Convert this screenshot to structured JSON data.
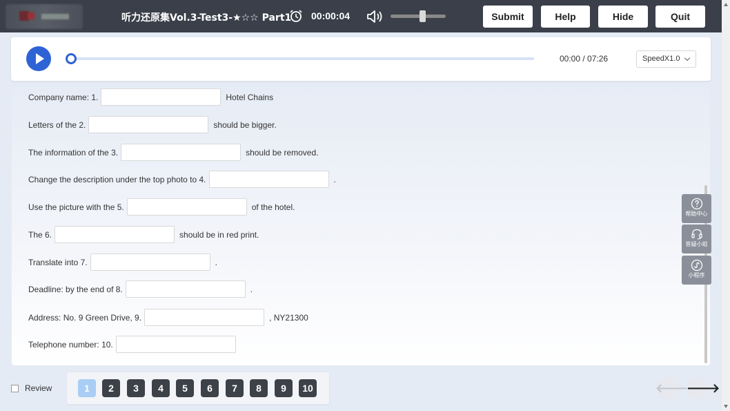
{
  "header": {
    "title": "听力还原集Vol.3-Test3-★☆☆ Part1",
    "timer": "00:00:04",
    "volume_level": 0.58,
    "buttons": {
      "submit": "Submit",
      "help": "Help",
      "hide": "Hide",
      "quit": "Quit"
    }
  },
  "player": {
    "time": "00:00 / 07:26",
    "speed": "SpeedX1.0",
    "progress": 0
  },
  "questions": [
    {
      "before": "Company name: 1.",
      "after": "Hotel Chains",
      "value": ""
    },
    {
      "before": "Letters of the 2.",
      "after": "should be bigger.",
      "value": ""
    },
    {
      "before": "The information of the 3.",
      "after": "should be removed.",
      "value": ""
    },
    {
      "before": "Change the description under the top photo to 4.",
      "after": ".",
      "value": ""
    },
    {
      "before": "Use the picture with the 5.",
      "after": "of the hotel.",
      "value": ""
    },
    {
      "before": "The 6.",
      "after": "should be in red print.",
      "value": ""
    },
    {
      "before": "Translate into 7.",
      "after": ".",
      "value": ""
    },
    {
      "before": "Deadline: by the end of 8.",
      "after": ".",
      "value": ""
    },
    {
      "before": "Address: No. 9 Green Drive, 9.",
      "after": ", NY21300",
      "value": ""
    },
    {
      "before": "Telephone number: 10.",
      "after": "",
      "value": ""
    }
  ],
  "side_tools": [
    {
      "label": "帮助中心",
      "icon": "help-circle-icon"
    },
    {
      "label": "答疑小组",
      "icon": "headset-icon"
    },
    {
      "label": "小程序",
      "icon": "mini-program-icon"
    }
  ],
  "footer": {
    "review_label": "Review",
    "numbers": [
      "1",
      "2",
      "3",
      "4",
      "5",
      "6",
      "7",
      "8",
      "9",
      "10"
    ],
    "active_number": "1",
    "prev_arrow": "🡐",
    "next_arrow": "🡒"
  },
  "colors": {
    "topbar": "#3a3f4a",
    "accent": "#2e63d6",
    "active_number": "#a9cdf4",
    "number_button": "#3d4148"
  }
}
